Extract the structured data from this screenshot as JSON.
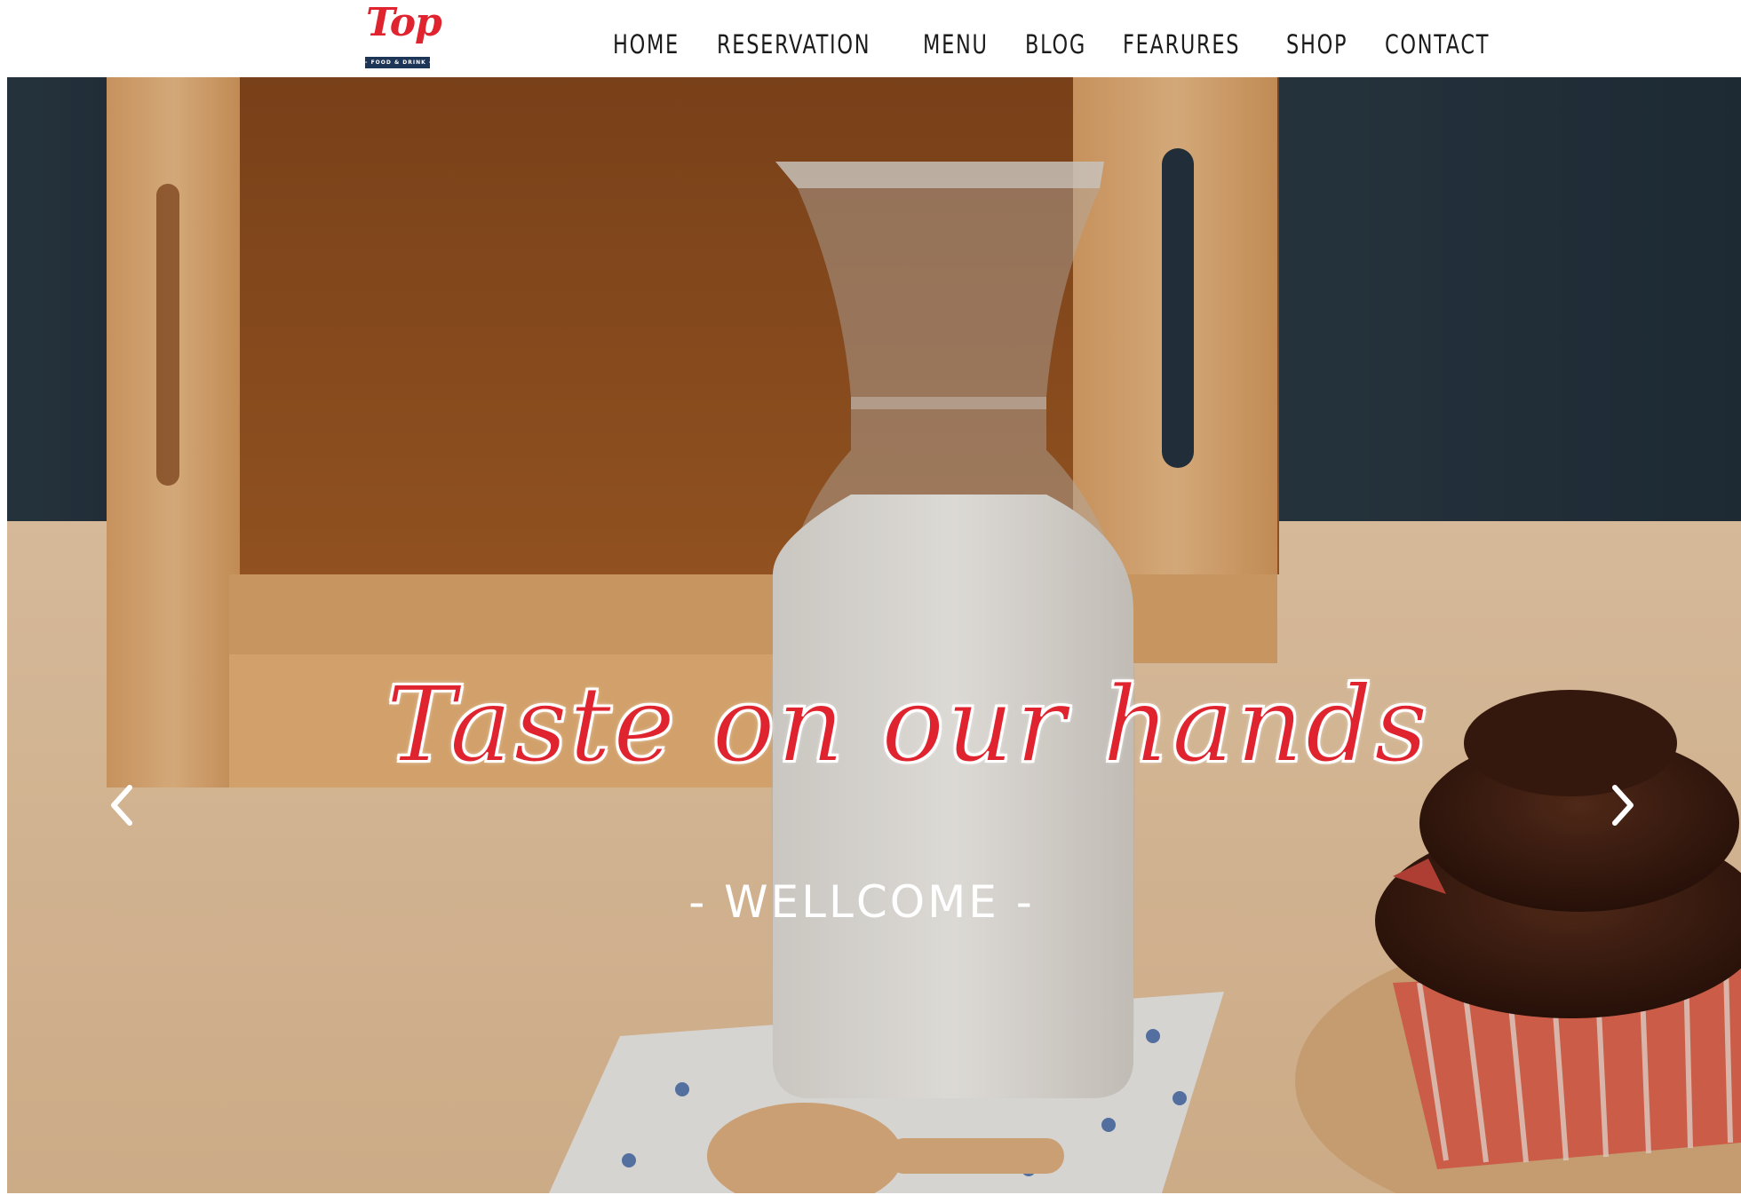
{
  "logo": {
    "script_text": "Top",
    "band_text": "- FOOD & DRINK -",
    "brand_color": "#e0242f",
    "band_color": "#1d3557"
  },
  "nav": {
    "items": [
      {
        "label": "HOME"
      },
      {
        "label": "RESERVATION"
      },
      {
        "label": "MENU"
      },
      {
        "label": "BLOG"
      },
      {
        "label": "FEARURES"
      },
      {
        "label": "SHOP"
      },
      {
        "label": "CONTACT"
      }
    ]
  },
  "hero": {
    "title": "Taste on our hands",
    "subtitle": "- WELLCOME -",
    "title_color": "#e0242f",
    "prev_icon": "chevron-left-icon",
    "next_icon": "chevron-right-icon"
  }
}
